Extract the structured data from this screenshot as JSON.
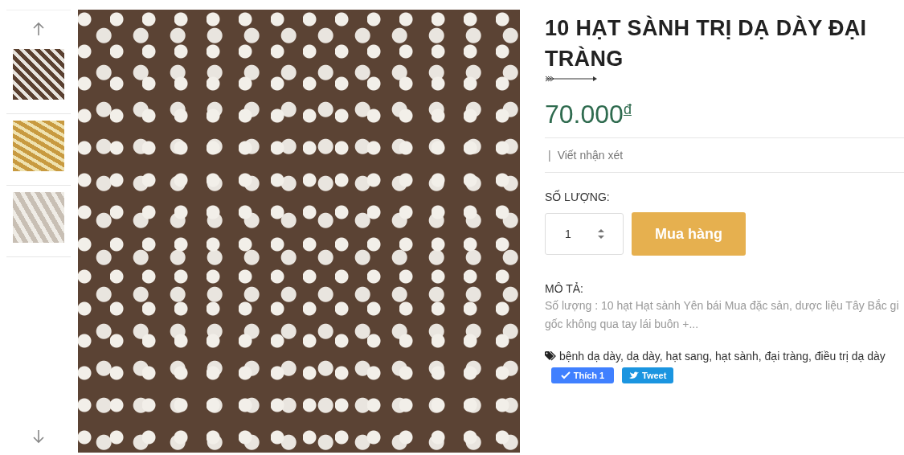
{
  "gallery": {
    "thumbnails": [
      {
        "kind": "seeds-dark"
      },
      {
        "kind": "seeds-yellow"
      },
      {
        "kind": "seeds-pale"
      }
    ]
  },
  "product": {
    "title": "10 HẠT SÀNH TRỊ DẠ DÀY ĐẠI TRÀNG",
    "price": "70.000",
    "currency": "đ",
    "review_link": "Viết nhận xét",
    "review_separator": "|",
    "quantity_label": "SỐ LƯỢNG:",
    "quantity": "1",
    "buy_button": "Mua hàng",
    "description_label": "MÔ TẢ:",
    "description_lines": [
      "Số lượng : 10 hạt Hạt sành Yên bái Mua đặc sản, dược liệu Tây Bắc gi",
      "gốc không qua tay lái buôn +..."
    ],
    "tags": "bệnh dạ dày, dạ dày, hạt sang, hạt sành, đại tràng, điều trị dạ dày",
    "like_button": "Thích 1",
    "tweet_button": "Tweet"
  }
}
